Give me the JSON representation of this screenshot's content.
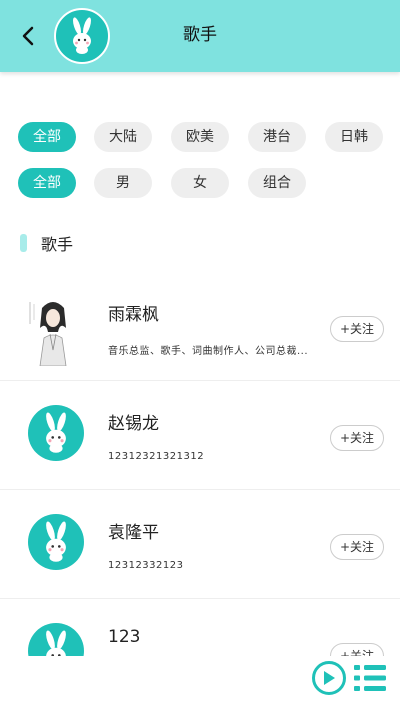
{
  "header": {
    "title": "歌手",
    "back_icon": "chevron-left-icon",
    "avatar_icon": "bunny-avatar-icon"
  },
  "filters": {
    "region": [
      "全部",
      "大陆",
      "欧美",
      "港台",
      "日韩"
    ],
    "type": [
      "全部",
      "男",
      "女",
      "组合"
    ],
    "region_selected": "全部",
    "type_selected": "全部"
  },
  "section": {
    "title": "歌手"
  },
  "singers": [
    {
      "name": "雨霖枫",
      "desc": "音乐总监、歌手、词曲制作人、公司总裁...",
      "avatar": "photo",
      "follow_label": "+关注"
    },
    {
      "name": "赵锡龙",
      "desc": "12312321321312",
      "avatar": "bunny",
      "follow_label": "+关注"
    },
    {
      "name": "袁隆平",
      "desc": "12312332123",
      "avatar": "bunny",
      "follow_label": "+关注"
    },
    {
      "name": "123",
      "desc": "",
      "avatar": "bunny",
      "follow_label": "+关注"
    }
  ],
  "player": {
    "play_icon": "play-icon",
    "playlist_icon": "playlist-icon"
  },
  "colors": {
    "header_bg": "#7fe2df",
    "accent": "#1fc1b8",
    "chip_bg": "#eeeeee"
  }
}
